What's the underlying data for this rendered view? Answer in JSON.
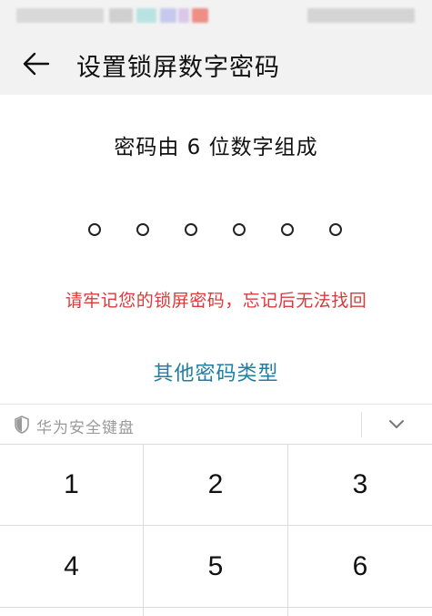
{
  "header": {
    "title": "设置锁屏数字密码"
  },
  "main": {
    "instruction": "密码由 6 位数字组成",
    "pin_length": 6,
    "warning": "请牢记您的锁屏密码，忘记后无法找回",
    "other_types_link": "其他密码类型"
  },
  "keyboard": {
    "label": "华为安全键盘",
    "keys": [
      "1",
      "2",
      "3",
      "4",
      "5",
      "6"
    ]
  },
  "colors": {
    "warning": "#d93a3a",
    "link": "#1f7ea1",
    "header_bg": "#f2f2f2"
  }
}
